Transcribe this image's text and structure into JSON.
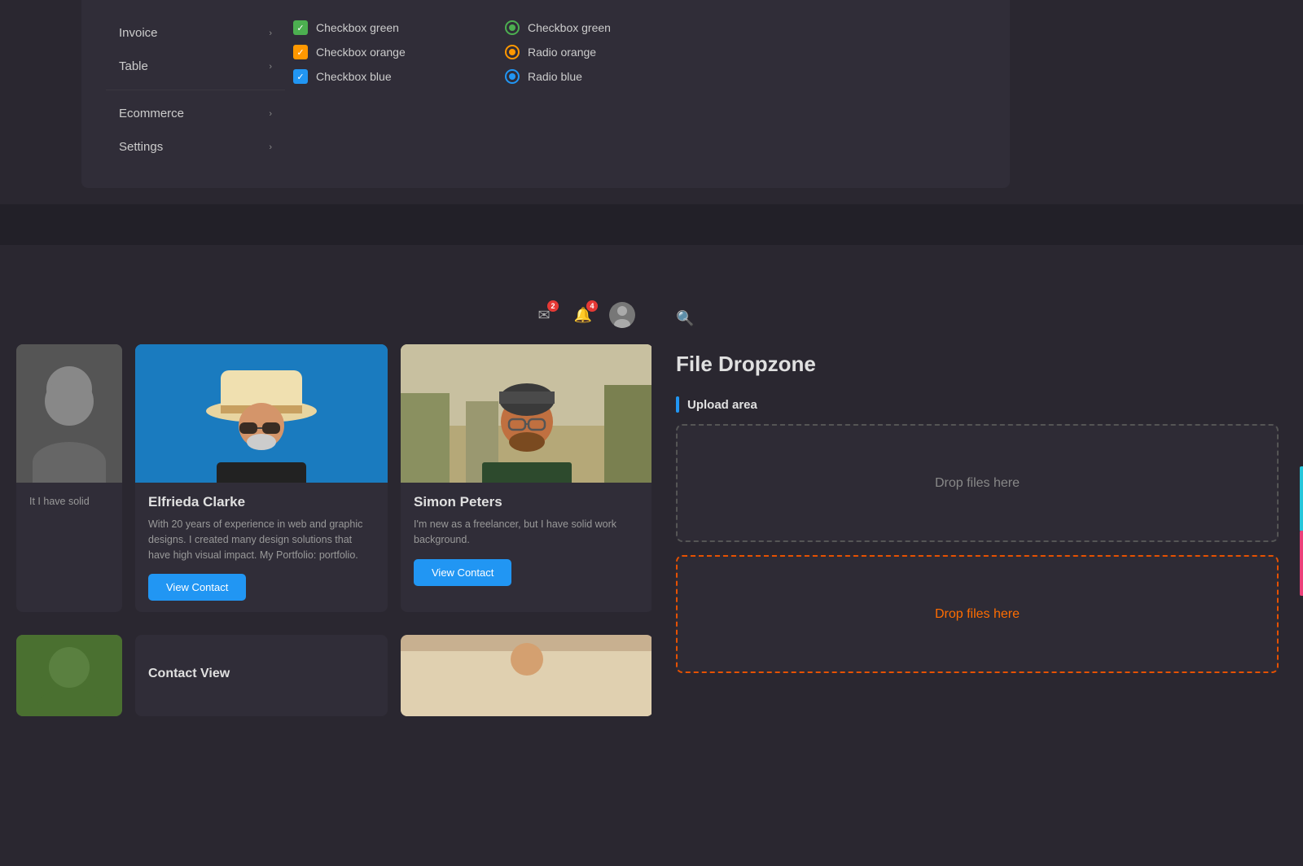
{
  "menu": {
    "items": [
      {
        "label": "Invoice",
        "has_sub": true
      },
      {
        "label": "Table",
        "has_sub": true
      },
      {
        "label": "Ecommerce",
        "has_sub": true
      },
      {
        "label": "Settings",
        "has_sub": true
      }
    ],
    "checkboxes": [
      {
        "type": "checkbox",
        "color": "green",
        "label": "Checkbox green"
      },
      {
        "type": "radio",
        "color": "green",
        "label": "Checkbox green"
      },
      {
        "type": "checkbox",
        "color": "orange",
        "label": "Checkbox orange"
      },
      {
        "type": "radio",
        "color": "orange",
        "label": "Radio orange"
      },
      {
        "type": "checkbox",
        "color": "blue",
        "label": "Checkbox blue"
      },
      {
        "type": "radio",
        "color": "blue",
        "label": "Radio blue"
      }
    ]
  },
  "header": {
    "mail_badge": "2",
    "bell_badge": "4"
  },
  "cards": [
    {
      "id": "card-partial-left",
      "name": "",
      "desc": "It I have solid",
      "truncated": true
    },
    {
      "id": "card-elfrieda",
      "name": "Elfrieda Clarke",
      "desc": "With 20 years of experience in web and graphic designs. I created many design solutions that have high visual impact. My Portfolio: portfolio.",
      "btn": "View Contact"
    },
    {
      "id": "card-simon",
      "name": "Simon Peters",
      "desc": "I'm new as a freelancer, but I have solid work background.",
      "btn": "View Contact"
    }
  ],
  "bottom_row": [
    {
      "label": ""
    },
    {
      "label": "Contact View"
    },
    {
      "label": ""
    }
  ],
  "dropzone": {
    "title": "File Dropzone",
    "upload_section_label": "Upload area",
    "box1_text": "Drop files here",
    "box2_text": "Drop files here"
  }
}
